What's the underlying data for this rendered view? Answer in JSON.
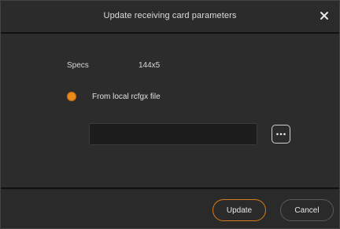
{
  "dialog": {
    "title": "Update receiving card parameters",
    "close_icon": "close-icon"
  },
  "specs": {
    "label": "Specs",
    "value": "144x5"
  },
  "source": {
    "option_label": "From local rcfgx file",
    "selected": true,
    "accent_color": "#ee8a19",
    "file_path": "",
    "browse_icon": "ellipsis-icon"
  },
  "footer": {
    "update_label": "Update",
    "cancel_label": "Cancel"
  }
}
